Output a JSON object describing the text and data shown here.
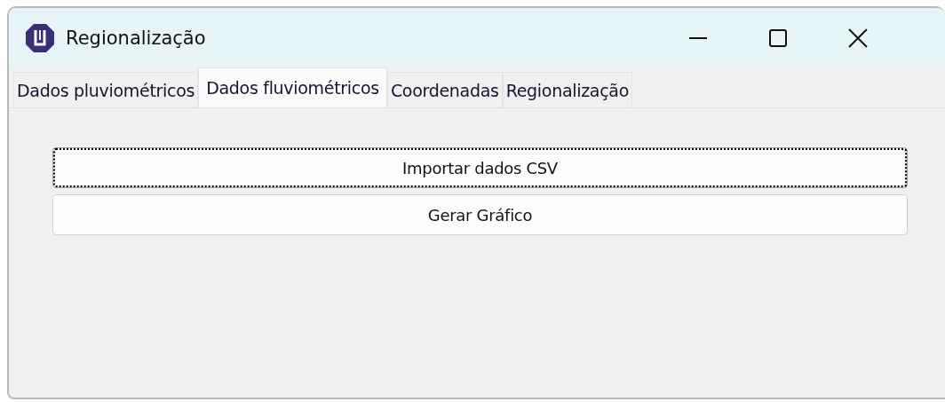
{
  "window": {
    "title": "Regionalização"
  },
  "tabs": [
    {
      "label": "Dados pluviométricos",
      "selected": false
    },
    {
      "label": "Dados fluviométricos",
      "selected": true
    },
    {
      "label": "Coordenadas",
      "selected": false
    },
    {
      "label": "Regionalização",
      "selected": false
    }
  ],
  "buttons": [
    {
      "label": "Importar dados CSV",
      "focused": true
    },
    {
      "label": "Gerar Gráfico",
      "focused": false
    }
  ]
}
